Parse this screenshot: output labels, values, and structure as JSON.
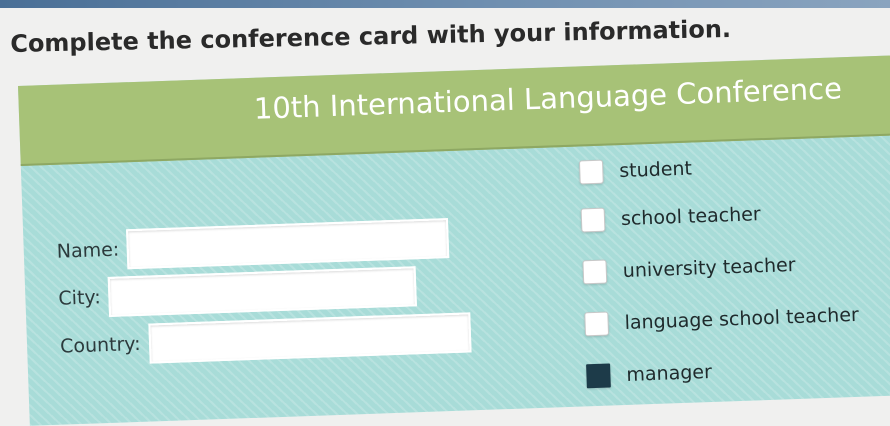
{
  "instruction": "Complete the conference card with your information.",
  "card": {
    "title": "10th International Language Conference",
    "fields": [
      {
        "label": "Name:",
        "value": ""
      },
      {
        "label": "City:",
        "value": ""
      },
      {
        "label": "Country:",
        "value": ""
      }
    ],
    "options": [
      {
        "label": "student",
        "checked": false
      },
      {
        "label": "school teacher",
        "checked": false
      },
      {
        "label": "university teacher",
        "checked": false
      },
      {
        "label": "language school teacher",
        "checked": false
      },
      {
        "label": "manager",
        "checked": true
      }
    ]
  },
  "colors": {
    "header_green": "#a7c277",
    "card_aqua": "#a8dcd8",
    "checkbox_filled": "#1d3b49"
  }
}
